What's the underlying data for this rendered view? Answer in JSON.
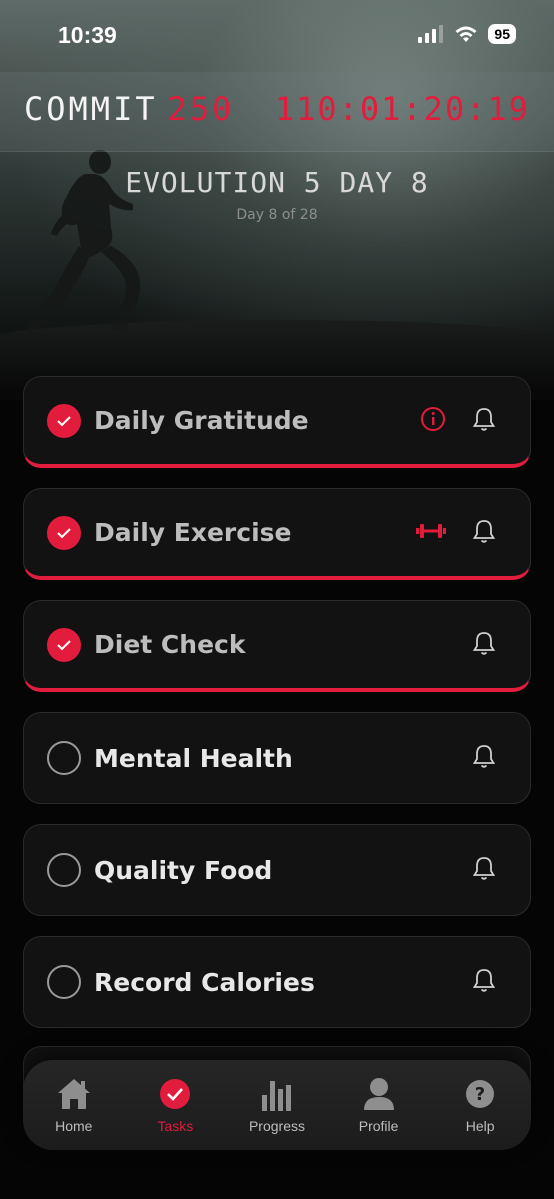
{
  "status_bar": {
    "time": "10:39",
    "battery": "95"
  },
  "header": {
    "brand": "COMMIT",
    "brand_number": "250",
    "countdown": "110:01:20:19"
  },
  "program": {
    "title": "EVOLUTION 5 DAY 8",
    "subtitle": "Day 8 of 28"
  },
  "tasks": [
    {
      "label": "Daily Gratitude",
      "done": true,
      "extra_icon": "info-icon"
    },
    {
      "label": "Daily Exercise",
      "done": true,
      "extra_icon": "dumbbell-icon"
    },
    {
      "label": "Diet Check",
      "done": true
    },
    {
      "label": "Mental Health",
      "done": false
    },
    {
      "label": "Quality Food",
      "done": false
    },
    {
      "label": "Record Calories",
      "done": false
    }
  ],
  "tabs": [
    {
      "label": "Home",
      "icon": "home-icon"
    },
    {
      "label": "Tasks",
      "icon": "check-circle-icon",
      "active": true
    },
    {
      "label": "Progress",
      "icon": "bar-chart-icon"
    },
    {
      "label": "Profile",
      "icon": "person-icon"
    },
    {
      "label": "Help",
      "icon": "help-icon"
    }
  ],
  "colors": {
    "accent": "#e21c3c",
    "background": "#050505",
    "card": "#121212"
  }
}
